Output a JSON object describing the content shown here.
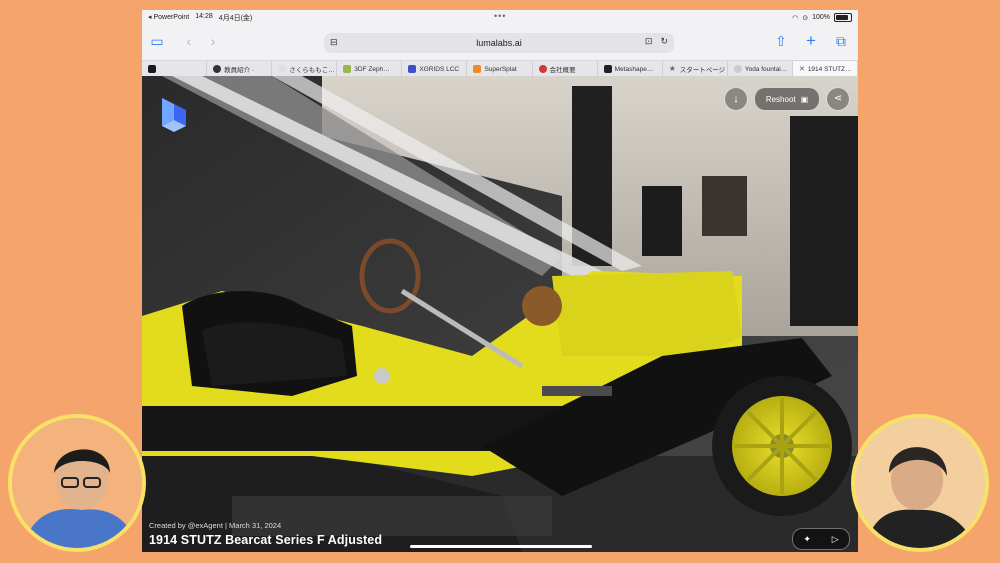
{
  "status_bar": {
    "back_app": "◂ PowerPoint",
    "time": "14:28",
    "date": "4月4日(金)",
    "battery": "100%"
  },
  "browser": {
    "url": "lumalabs.ai",
    "tabs": [
      {
        "label": "",
        "color": "#1a1a1a"
      },
      {
        "label": "教員紹介 ·",
        "color": "#333333"
      },
      {
        "label": "さくらももこ…",
        "color": "#e0e0e0"
      },
      {
        "label": "3DF Zeph…",
        "color": "#9ab84a"
      },
      {
        "label": "XGRIDS LCC",
        "color": "#3b52c4"
      },
      {
        "label": "SuperSplat",
        "color": "#f08a24"
      },
      {
        "label": "会社概要",
        "color": "#d23a3a"
      },
      {
        "label": "Metashape…",
        "color": "#222222"
      },
      {
        "label": "スタートページ",
        "color": "#888888"
      },
      {
        "label": "Yoda fountai…",
        "color": "#cccccc"
      },
      {
        "label": "1914 STUTZ…",
        "color": "#555555",
        "active": true
      }
    ]
  },
  "viewer": {
    "reshoot_label": "Reshoot",
    "credit": "Created by @exAgent | March 31, 2024",
    "title": "1914 STUTZ Bearcat Series F Adjusted"
  }
}
